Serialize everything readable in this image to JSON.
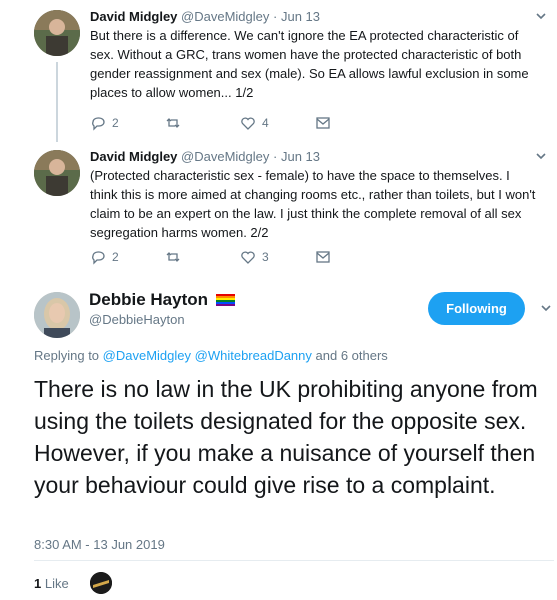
{
  "replies": [
    {
      "name": "David Midgley",
      "handle": "@DaveMidgley",
      "separator": "·",
      "date": "Jun 13",
      "text": "But there is a difference. We can't ignore the EA protected characteristic of sex. Without a GRC, trans women have the protected characteristic of both gender reassignment and sex (male). So EA allows lawful exclusion in some places to allow women... 1/2",
      "reply_count": "2",
      "retweet_count": "",
      "like_count": "4"
    },
    {
      "name": "David Midgley",
      "handle": "@DaveMidgley",
      "separator": "·",
      "date": "Jun 13",
      "text": "(Protected characteristic sex - female) to have the space to themselves. I think this is more aimed at changing rooms etc., rather than toilets, but I won't claim to be an expert on the law. I just think the complete removal of all sex segregation harms women. 2/2",
      "reply_count": "2",
      "retweet_count": "",
      "like_count": "3"
    }
  ],
  "main_tweet": {
    "name": "Debbie Hayton",
    "handle": "@DebbieHayton",
    "follow_label": "Following",
    "replying_prefix": "Replying to",
    "mention_1": "@DaveMidgley",
    "mention_2": "@WhitebreadDanny",
    "replying_suffix": "and 6 others",
    "text": "There is no law in the UK prohibiting anyone from using the toilets designated for the opposite sex. However, if you make a nuisance of yourself then your behaviour could give rise to a complaint.",
    "timestamp": "8:30 AM - 13 Jun 2019",
    "like_count": "1",
    "like_label": "Like"
  },
  "colors": {
    "accent": "#1da1f2",
    "secondary_text": "#657786",
    "primary_text": "#14171a",
    "divider": "#e6ecf0"
  },
  "icons": [
    "avatar",
    "chevron-down-icon",
    "reply-icon",
    "retweet-icon",
    "like-icon",
    "direct-message-icon",
    "rainbow-flag-icon"
  ]
}
